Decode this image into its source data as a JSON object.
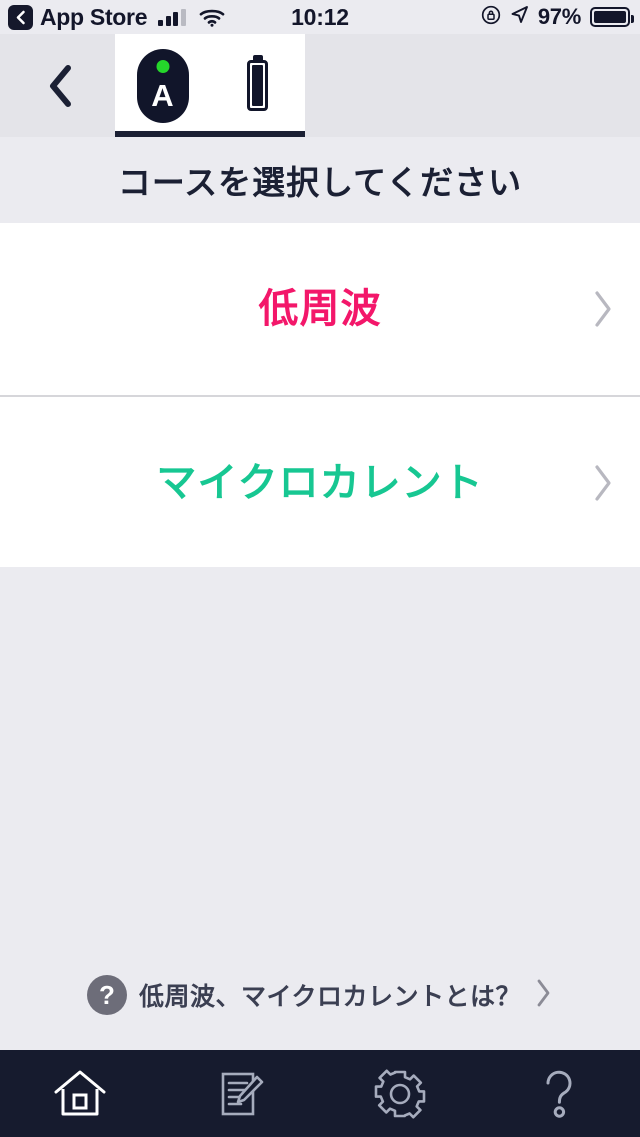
{
  "statusbar": {
    "back_app_label": "App Store",
    "back_icon": "chevron-left-icon",
    "signal_icon": "cellular-signal-icon",
    "wifi_icon": "wifi-icon",
    "time": "10:12",
    "rotation_lock_icon": "rotation-lock-icon",
    "location_icon": "location-arrow-icon",
    "battery_percent": "97%",
    "battery_icon": "battery-full-icon"
  },
  "navbar": {
    "back_icon": "chevron-left-icon",
    "tabs": [
      {
        "name": "device-tab",
        "icon": "device-a-icon",
        "letter": "A",
        "led_color": "#25d62b",
        "active": true
      },
      {
        "name": "battery-tab",
        "icon": "battery-vertical-icon",
        "active": false
      }
    ]
  },
  "page": {
    "heading": "コースを選択してください"
  },
  "courses": [
    {
      "label": "低周波",
      "color": "#f3176a",
      "chevron_icon": "chevron-right-icon"
    },
    {
      "label": "マイクロカレント",
      "color": "#17c792",
      "chevron_icon": "chevron-right-icon"
    }
  ],
  "help_link": {
    "badge_icon": "question-mark-circle-icon",
    "badge_glyph": "?",
    "label": "低周波、マイクロカレントとは？",
    "chevron_icon": "chevron-right-icon"
  },
  "tabbar": {
    "items": [
      {
        "name": "tab-home",
        "icon": "home-icon",
        "active": true
      },
      {
        "name": "tab-records",
        "icon": "note-edit-icon",
        "active": false
      },
      {
        "name": "tab-settings",
        "icon": "gear-icon",
        "active": false
      },
      {
        "name": "tab-help",
        "icon": "question-mark-icon",
        "active": false
      }
    ]
  },
  "colors": {
    "page_background": "#ebebf0",
    "navbar_background": "#e4e4e9",
    "list_background": "#ffffff",
    "divider": "#d6d6da",
    "ink": "#1b2034",
    "tabbar_background": "#161b2e",
    "accent_pink": "#f3176a",
    "accent_teal": "#17c792",
    "chevron_gray": "#b8b8c0"
  }
}
